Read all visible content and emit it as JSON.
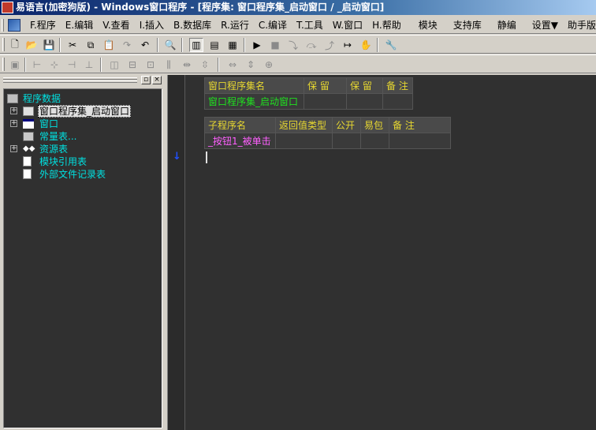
{
  "window": {
    "title": "易语言(加密狗版) - Windows窗口程序 - [程序集: 窗口程序集_启动窗口 / _启动窗口]"
  },
  "menu": {
    "items": [
      {
        "label": "F.程序"
      },
      {
        "label": "E.编辑"
      },
      {
        "label": "V.查看"
      },
      {
        "label": "I.插入"
      },
      {
        "label": "B.数据库"
      },
      {
        "label": "R.运行"
      },
      {
        "label": "C.编译"
      },
      {
        "label": "T.工具"
      },
      {
        "label": "W.窗口"
      },
      {
        "label": "H.帮助"
      },
      {
        "label": "模块"
      },
      {
        "label": "支持库"
      },
      {
        "label": "静编"
      },
      {
        "label": "设置▼"
      },
      {
        "label": "助手版"
      }
    ]
  },
  "toolbar": {
    "icons": [
      "new-file-icon",
      "open-folder-icon",
      "save-icon",
      "cut-icon",
      "copy-icon",
      "paste-icon",
      "redo-icon",
      "undo-icon",
      "find-icon",
      "layout-view-1-icon",
      "layout-view-2-icon",
      "layout-view-3-icon",
      "run-icon",
      "stop-icon",
      "step-in-icon",
      "step-over-icon",
      "step-out-icon",
      "run-to-cursor-icon",
      "hand-icon",
      "debug-tool-icon"
    ]
  },
  "tree": {
    "root": "程序数据",
    "items": [
      {
        "label": "窗口程序集_启动窗口",
        "icon": "class-module-icon",
        "selected": true,
        "expander": "+"
      },
      {
        "label": "窗口",
        "icon": "window-icon",
        "expander": "+"
      },
      {
        "label": "常量表...",
        "icon": "constant-icon"
      },
      {
        "label": "资源表",
        "icon": "resource-icon",
        "expander": "+"
      },
      {
        "label": "模块引用表",
        "icon": "module-ref-icon"
      },
      {
        "label": "外部文件记录表",
        "icon": "external-file-icon"
      }
    ]
  },
  "assembly_table": {
    "headers": [
      "窗口程序集名",
      "保 留",
      "保 留",
      "备 注"
    ],
    "row": [
      "窗口程序集_启动窗口",
      "",
      "",
      ""
    ]
  },
  "sub_table": {
    "headers": [
      "子程序名",
      "返回值类型",
      "公开",
      "易包",
      "备 注"
    ],
    "row": [
      "_按钮1_被单击",
      "",
      "",
      "",
      ""
    ]
  },
  "colors": {
    "editor_bg": "#303030",
    "header_text": "#e8d830",
    "assembly_name": "#20e020",
    "sub_name": "#ff60ff",
    "tree_text": "#00e0e0"
  }
}
